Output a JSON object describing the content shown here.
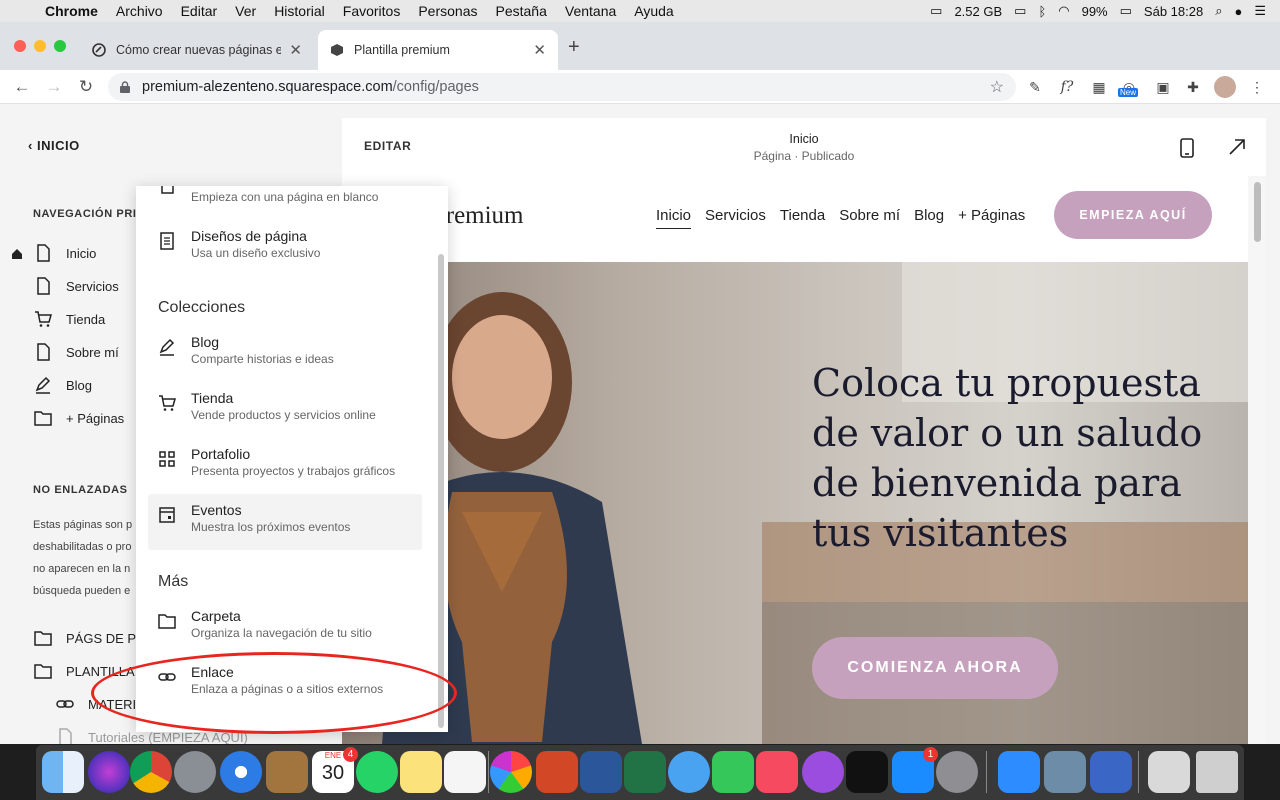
{
  "menubar": {
    "app": "Chrome",
    "items": [
      "Archivo",
      "Editar",
      "Ver",
      "Historial",
      "Favoritos",
      "Personas",
      "Pestaña",
      "Ventana",
      "Ayuda"
    ],
    "memory": "2.52 GB",
    "battery": "99%",
    "clock": "Sáb 18:28"
  },
  "browser": {
    "tabs": [
      {
        "title": "Cómo crear nuevas páginas en"
      },
      {
        "title": "Plantilla premium"
      }
    ],
    "url_host": "premium-alezenteno.squarespace.com",
    "url_path": "/config/pages",
    "ext_badge": "New"
  },
  "left": {
    "back_label": "INICIO",
    "nav_section": "NAVEGACIÓN PRI",
    "items": [
      {
        "label": "Inicio"
      },
      {
        "label": "Servicios"
      },
      {
        "label": "Tienda"
      },
      {
        "label": "Sobre mí"
      },
      {
        "label": "Blog"
      },
      {
        "label": "+ Páginas"
      }
    ],
    "unlinked_section": "NO ENLAZADAS",
    "hint_lines": [
      "Estas páginas son p",
      "deshabilitadas o pro",
      "no aparecen en la n",
      "búsqueda pueden e"
    ],
    "folders": [
      {
        "label": "PÁGS DE PO"
      },
      {
        "label": "PLANTILLA P"
      }
    ],
    "subitems": [
      {
        "label": "MATERIA"
      },
      {
        "label": "Tutoriales (EMPIEZA AQUÍ)"
      }
    ]
  },
  "preview": {
    "edit_label": "EDITAR",
    "page_title": "Inicio",
    "page_status": "Página · Publicado",
    "logo": "lla premium",
    "links": [
      "Inicio",
      "Servicios",
      "Tienda",
      "Sobre mí",
      "Blog",
      "+ Páginas"
    ],
    "cta": "EMPIEZA AQUÍ",
    "headline": "Coloca tu propuesta de valor o un saludo de bienvenida para tus visitantes",
    "cta2": "COMIENZA AHORA"
  },
  "menu": {
    "top_partial_sub": "Empieza con una página en blanco",
    "layouts": {
      "title": "Diseños de página",
      "sub": "Usa un diseño exclusivo"
    },
    "collections_heading": "Colecciones",
    "collections": [
      {
        "title": "Blog",
        "sub": "Comparte historias e ideas",
        "icon": "blog-icon"
      },
      {
        "title": "Tienda",
        "sub": "Vende productos y servicios online",
        "icon": "cart-icon"
      },
      {
        "title": "Portafolio",
        "sub": "Presenta proyectos y trabajos gráficos",
        "icon": "grid-icon"
      },
      {
        "title": "Eventos",
        "sub": "Muestra los próximos eventos",
        "icon": "calendar-icon"
      }
    ],
    "more_heading": "Más",
    "more": [
      {
        "title": "Carpeta",
        "sub": "Organiza la navegación de tu sitio",
        "icon": "folder-icon"
      },
      {
        "title": "Enlace",
        "sub": "Enlaza a páginas o a sitios externos",
        "icon": "link-icon"
      }
    ]
  },
  "dock": {
    "calendar_month": "ENE",
    "calendar_day": "30",
    "calendar_badge": "4",
    "appstore_badge": "1"
  },
  "colors": {
    "accent": "#c6a1bd",
    "annotation": "#e6261f"
  }
}
